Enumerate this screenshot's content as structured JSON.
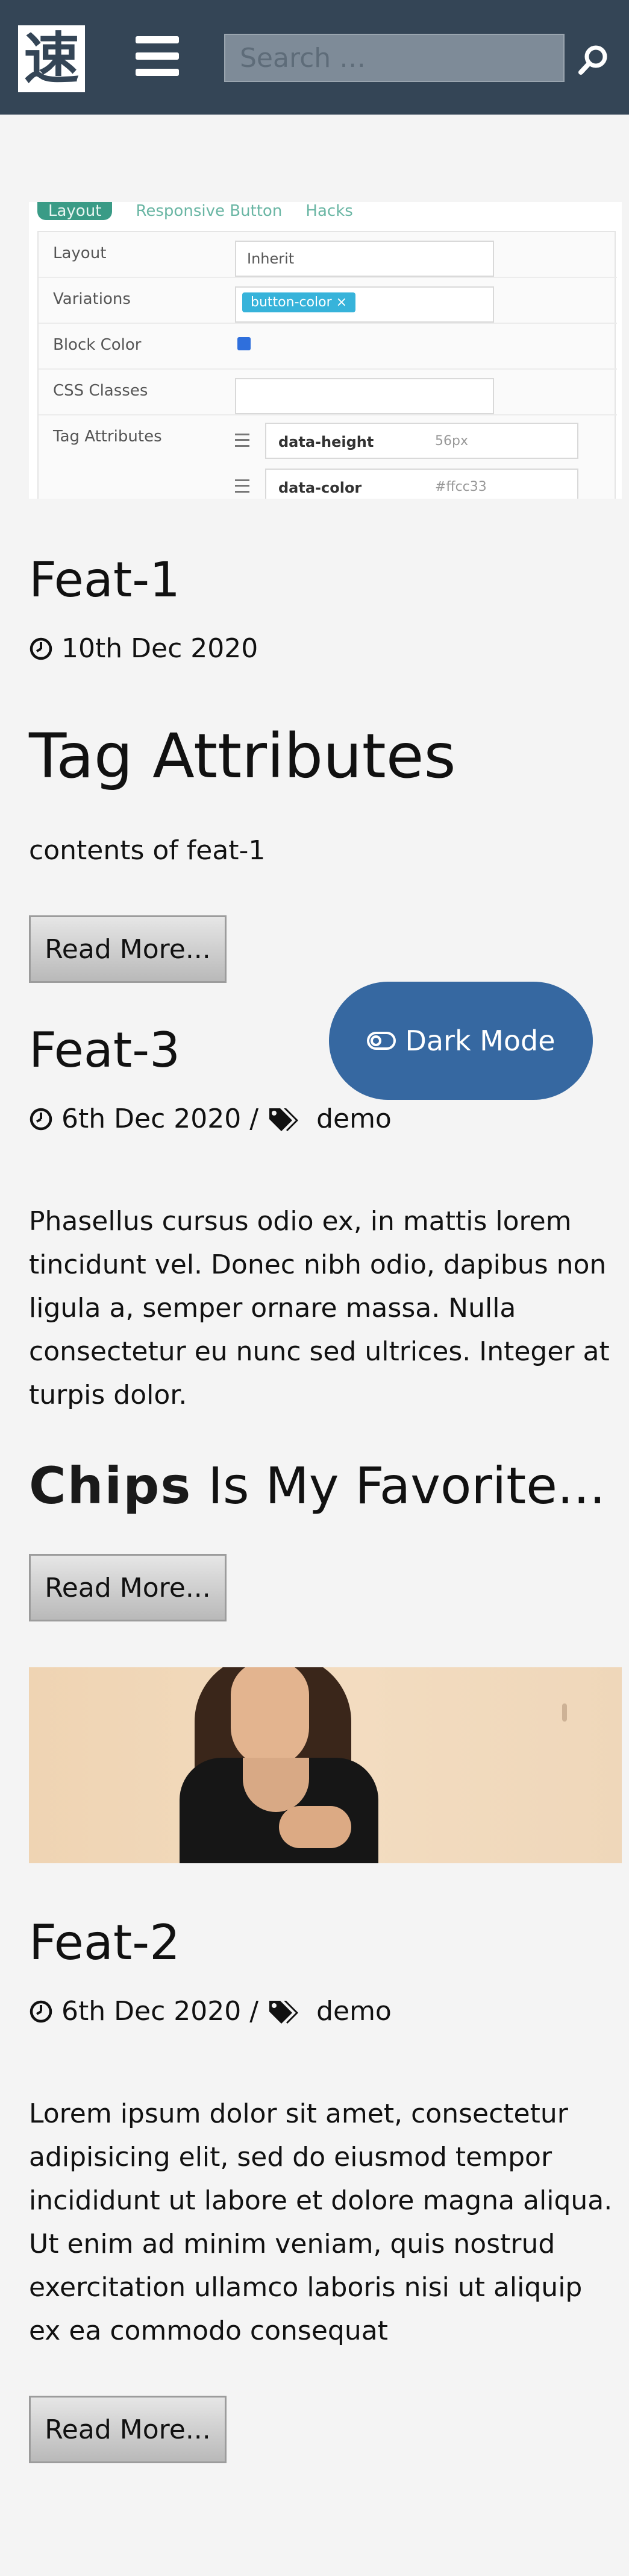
{
  "header": {
    "logo_text": "速",
    "search_placeholder": "Search …"
  },
  "featured_image_1": {
    "tabs": [
      "Layout",
      "Responsive Button",
      "Hacks"
    ],
    "rows": {
      "layout_label": "Layout",
      "layout_value": "Inherit",
      "variations_label": "Variations",
      "variations_chip": "button-color ×",
      "block_color_label": "Block Color",
      "css_classes_label": "CSS Classes",
      "tag_attributes_label": "Tag Attributes",
      "attributes": [
        {
          "key": "data-height",
          "value": "56px"
        },
        {
          "key": "data-color",
          "value": "#ffcc33"
        }
      ]
    }
  },
  "articles": [
    {
      "title": "Feat-1",
      "date": "10th Dec 2020",
      "subheading": "Tag Attributes",
      "excerpt": "contents of feat-1",
      "read_more": "Read More..."
    },
    {
      "title": "Feat-3",
      "date": "6th Dec 2020",
      "separator": "/",
      "tag": "demo",
      "excerpt": "Phasellus cursus odio ex, in mattis lorem tincidunt vel. Donec nibh odio, dapibus non ligula a, semper ornare massa. Nulla consectetur eu nunc sed ultrices. Integer at turpis dolor.",
      "subheading_image_word": "Chips",
      "subheading_rest": "Is My Favorite...",
      "read_more": "Read More..."
    },
    {
      "title": "Feat-2",
      "date": "6th Dec 2020",
      "separator": "/",
      "tag": "demo",
      "excerpt": "Lorem ipsum dolor sit amet, consectetur adipisicing elit, sed do eiusmod tempor incididunt ut labore et dolore magna aliqua. Ut enim ad minim veniam, quis nostrud exercitation ullamco laboris nisi ut aliquip ex ea commodo consequat",
      "read_more": "Read More..."
    }
  ],
  "dark_mode_toggle": {
    "label": "Dark Mode"
  },
  "colors": {
    "header_bg": "#344556",
    "page_bg": "#f4f4f4",
    "toggle_bg": "#3668a1"
  },
  "icons": [
    "hamburger-menu-icon",
    "search-icon",
    "clock-icon",
    "tags-icon",
    "toggle-icon"
  ]
}
